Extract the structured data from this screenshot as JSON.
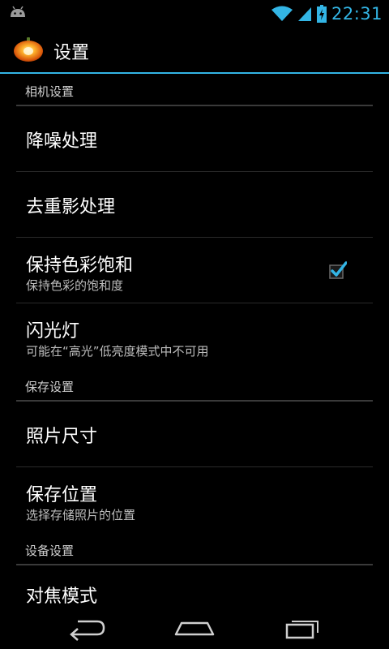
{
  "status_bar": {
    "time": "22:31",
    "icons": [
      "android-notification-icon",
      "wifi-icon",
      "signal-icon",
      "battery-charging-icon"
    ],
    "accent_color": "#33b5e5"
  },
  "action_bar": {
    "title": "设置",
    "app_icon": "pumpkin-camera-icon"
  },
  "sections": [
    {
      "header": "相机设置",
      "items": [
        {
          "title": "降噪处理",
          "summary": ""
        },
        {
          "title": "去重影处理",
          "summary": ""
        },
        {
          "title": "保持色彩饱和",
          "summary": "保持色彩的饱和度",
          "checkbox": true
        },
        {
          "title": "闪光灯",
          "summary": "可能在“高光”低亮度模式中不可用"
        }
      ]
    },
    {
      "header": "保存设置",
      "items": [
        {
          "title": "照片尺寸",
          "summary": ""
        },
        {
          "title": "保存位置",
          "summary": "选择存储照片的位置"
        }
      ]
    },
    {
      "header": "设备设置",
      "items": [
        {
          "title": "对焦模式",
          "summary": ""
        }
      ]
    }
  ],
  "nav_bar": {
    "buttons": [
      "back-icon",
      "home-icon",
      "recent-apps-icon"
    ]
  }
}
